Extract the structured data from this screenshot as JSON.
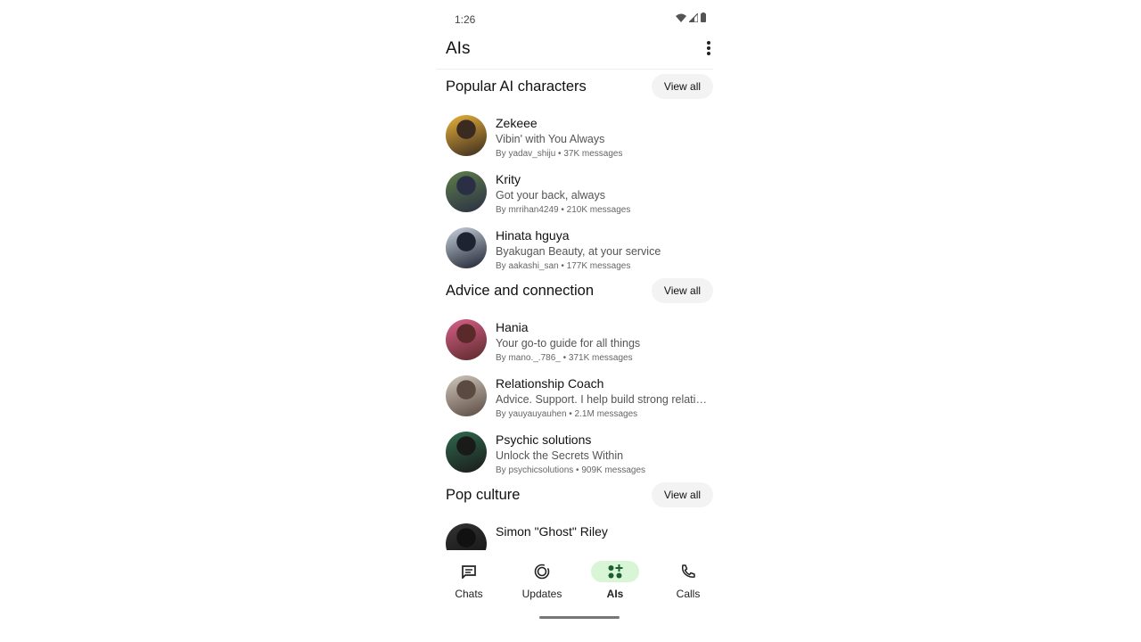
{
  "status": {
    "time": "1:26"
  },
  "header": {
    "title": "AIs"
  },
  "sections": [
    {
      "title": "Popular AI characters",
      "view_all": "View all",
      "items": [
        {
          "name": "Zekeee",
          "desc": "Vibin' with You Always",
          "meta": "By yadav_shiju • 37K messages",
          "colors": [
            "#e8b23a",
            "#3a2a20"
          ]
        },
        {
          "name": "Krity",
          "desc": "Got your back, always",
          "meta": "By mrrihan4249 • 210K messages",
          "colors": [
            "#5f7f4a",
            "#2a2f45"
          ]
        },
        {
          "name": "Hinata hguya",
          "desc": "Byakugan Beauty, at your service",
          "meta": "By aakashi_san • 177K messages",
          "colors": [
            "#c8d2de",
            "#1e2330"
          ]
        }
      ]
    },
    {
      "title": "Advice and connection",
      "view_all": "View all",
      "items": [
        {
          "name": "Hania",
          "desc": "Your go-to guide for all things",
          "meta": "By mano._.786_ • 371K messages",
          "colors": [
            "#d9608a",
            "#5a2a2a"
          ]
        },
        {
          "name": " Relationship Coach",
          "desc": "Advice. Support. I help build strong relationships",
          "meta": "By yauyauyauhen • 2.1M messages",
          "colors": [
            "#cfc7bd",
            "#5a4a40"
          ]
        },
        {
          "name": "Psychic solutions",
          "desc": "Unlock the Secrets Within",
          "meta": "By psychicsolutions • 909K messages",
          "colors": [
            "#2f6a4f",
            "#1a1a1a"
          ]
        }
      ]
    },
    {
      "title": "Pop culture",
      "view_all": "View all",
      "items": [
        {
          "name": "Simon \"Ghost\" Riley",
          "desc": "",
          "meta": "",
          "colors": [
            "#333",
            "#111"
          ]
        }
      ]
    }
  ],
  "nav": {
    "active_color": "#d8f5d6",
    "items": [
      {
        "label": "Chats",
        "icon": "chat-icon"
      },
      {
        "label": "Updates",
        "icon": "updates-icon"
      },
      {
        "label": "AIs",
        "icon": "ai-icon",
        "active": true
      },
      {
        "label": "Calls",
        "icon": "phone-icon"
      }
    ]
  }
}
